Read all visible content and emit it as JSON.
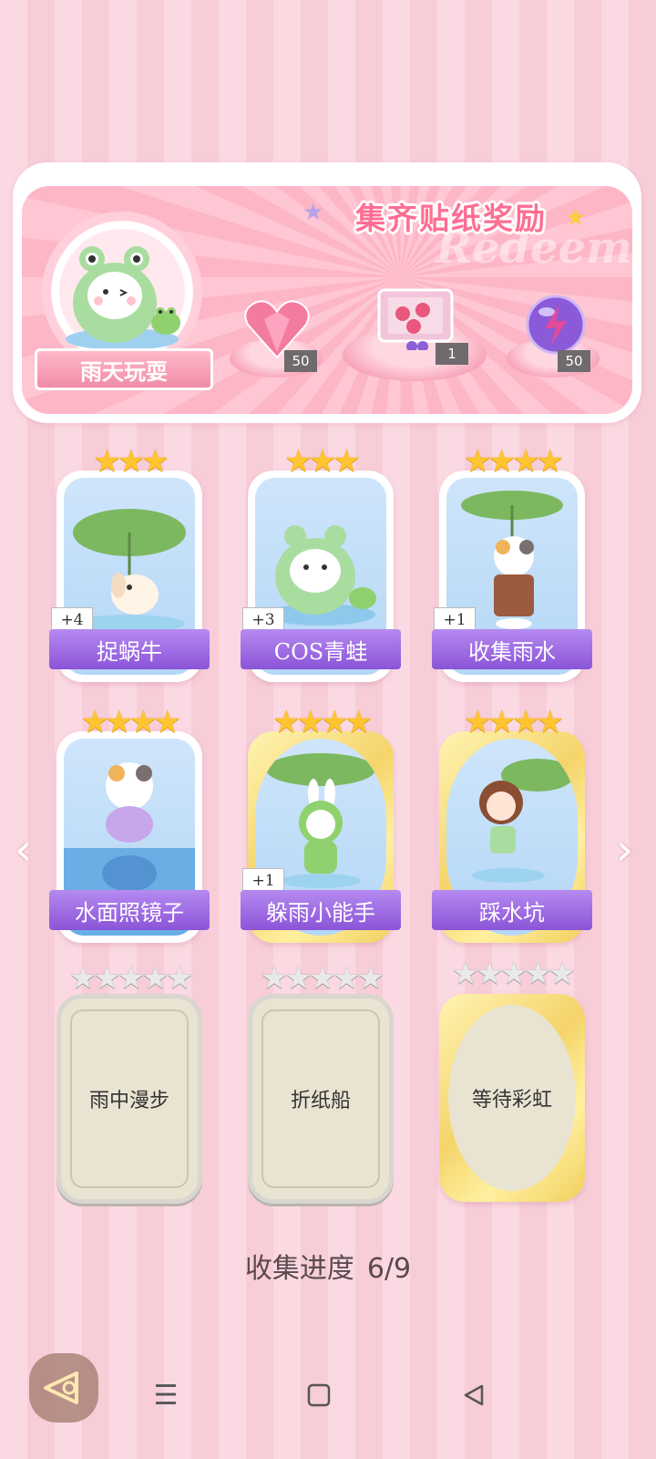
{
  "banner": {
    "title": "集齐贴纸奖励",
    "watermark": "Redeem",
    "theme_name": "雨天玩耍",
    "rewards": [
      {
        "icon": "heart-gem-icon",
        "count": "50"
      },
      {
        "icon": "gift-box-icon",
        "count": "1"
      },
      {
        "icon": "lightning-orb-icon",
        "count": "50"
      }
    ]
  },
  "stickers": [
    {
      "name": "捉蜗牛",
      "stars": 3,
      "count": "+4",
      "icon": "puppy-leaf-umbrella-icon"
    },
    {
      "name": "COS青蛙",
      "stars": 3,
      "count": "+3",
      "icon": "frog-hood-cat-icon"
    },
    {
      "name": "收集雨水",
      "stars": 4,
      "count": "+1",
      "icon": "calico-cat-leaf-icon"
    },
    {
      "name": "水面照镜子",
      "stars": 4,
      "count": "",
      "icon": "cat-reflection-icon"
    },
    {
      "name": "躲雨小能手",
      "stars": 4,
      "count": "+1",
      "icon": "bunny-frog-leaf-icon"
    },
    {
      "name": "踩水坑",
      "stars": 4,
      "count": "",
      "icon": "girl-puddle-icon"
    },
    {
      "name": "雨中漫步",
      "stars": 5,
      "locked": true
    },
    {
      "name": "折纸船",
      "stars": 5,
      "locked": true
    },
    {
      "name": "等待彩虹",
      "stars": 5,
      "locked": true
    }
  ],
  "progress": {
    "label": "收集进度",
    "value": "6/9"
  },
  "nav": {
    "prev": "‹",
    "next": "›"
  }
}
